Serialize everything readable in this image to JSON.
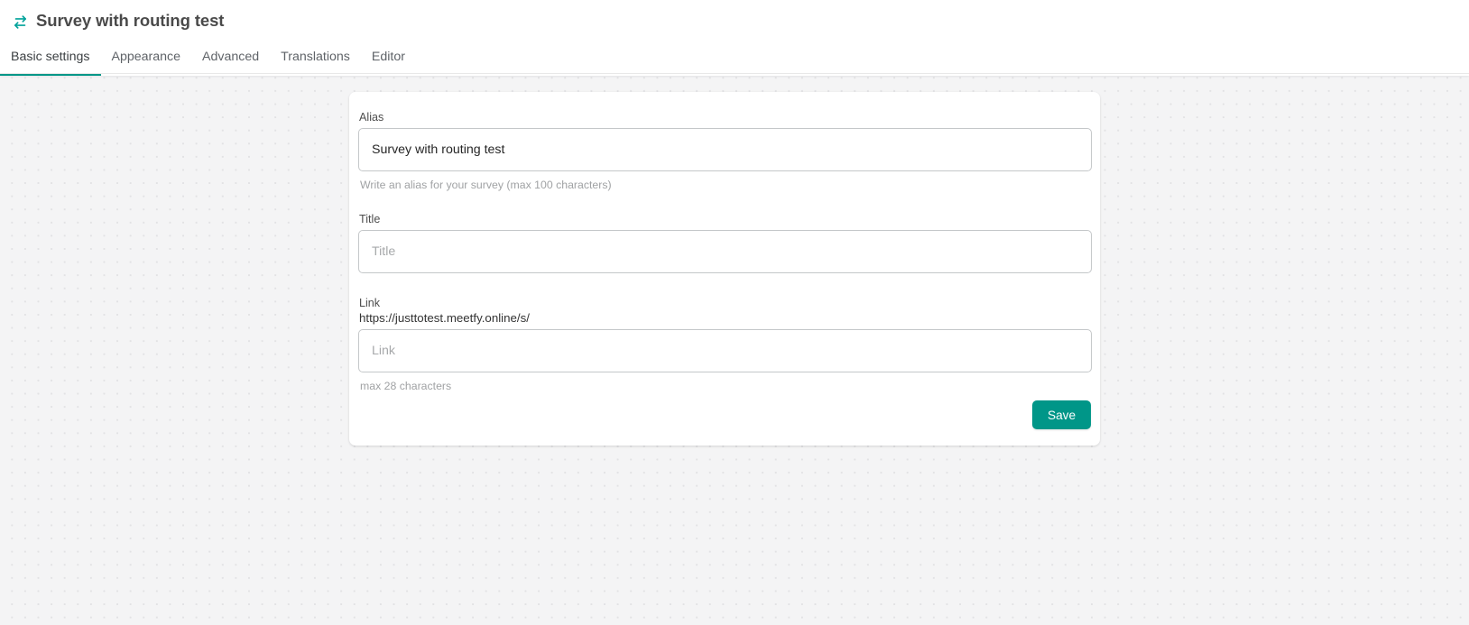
{
  "header": {
    "icon": "swap-horizontal-icon",
    "title": "Survey with routing test"
  },
  "tabs": {
    "active_index": 0,
    "items": [
      {
        "label": "Basic settings"
      },
      {
        "label": "Appearance"
      },
      {
        "label": "Advanced"
      },
      {
        "label": "Translations"
      },
      {
        "label": "Editor"
      }
    ]
  },
  "form": {
    "alias": {
      "label": "Alias",
      "value": "Survey with routing test",
      "placeholder": "",
      "hint": "Write an alias for your survey (max 100 characters)"
    },
    "title": {
      "label": "Title",
      "value": "",
      "placeholder": "Title",
      "hint": ""
    },
    "link": {
      "label": "Link",
      "prefix": "https://justtotest.meetfy.online/s/",
      "value": "",
      "placeholder": "Link",
      "hint": "max 28 characters"
    },
    "save_label": "Save"
  },
  "colors": {
    "accent": "#009688",
    "page_bg": "#f4f4f5",
    "card_bg": "#ffffff",
    "text": "#3c4043",
    "muted_text": "#a0a2a4"
  }
}
